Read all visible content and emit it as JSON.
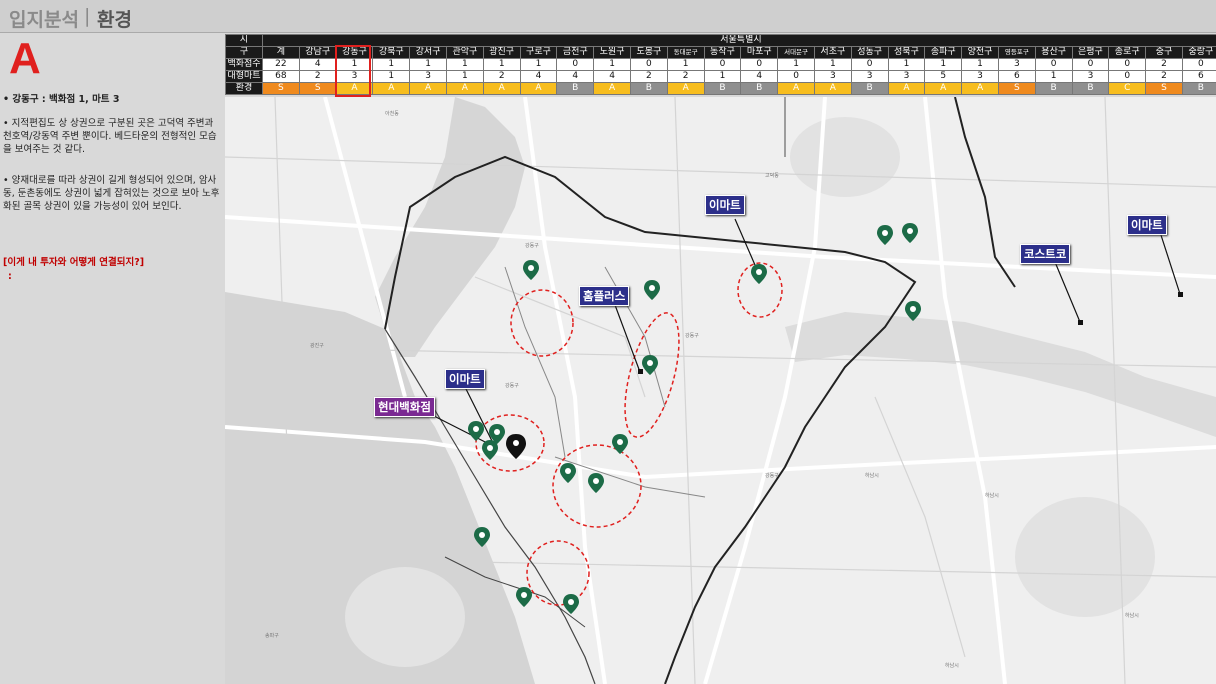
{
  "header": {
    "section": "입지분석",
    "separator": "|",
    "topic": "환경"
  },
  "left": {
    "grade": "A",
    "summary": "• 강동구 : 백화점 1, 마트 3",
    "para1": "• 지적편집도 상 상권으로 구분된 곳은 고덕역 주변과 천호역/강동역 주변 뿐이다. 베드타운의 전형적인 모습을 보여주는 것 같다.",
    "para2": "• 양재대로를 따라 상권이 길게 형성되어 있으며, 암사동, 둔촌동에도 상권이 넓게 잡혀있는 것으로 보아 노후화된 골목 상권이 있을 가능성이 있어 보인다.",
    "question": "[이게 내 투자와 어떻게 연결되지?]",
    "question_colon": ":"
  },
  "table": {
    "row1_label": "시",
    "city": "서울특별시",
    "row2_label": "구",
    "districts": [
      "계",
      "강남구",
      "강동구",
      "강북구",
      "강서구",
      "관악구",
      "광진구",
      "구로구",
      "금천구",
      "노원구",
      "도봉구",
      "동대문구",
      "동작구",
      "마포구",
      "서대문구",
      "서초구",
      "성동구",
      "성북구",
      "송파구",
      "양천구",
      "영등포구",
      "용산구",
      "은평구",
      "종로구",
      "중구",
      "중랑구"
    ],
    "dept_label": "백화점수",
    "dept": [
      "22",
      "4",
      "1",
      "1",
      "1",
      "1",
      "1",
      "1",
      "0",
      "1",
      "0",
      "1",
      "0",
      "0",
      "1",
      "1",
      "0",
      "1",
      "1",
      "1",
      "3",
      "0",
      "0",
      "0",
      "2",
      "0"
    ],
    "mart_label": "대형마트",
    "mart": [
      "68",
      "2",
      "3",
      "1",
      "3",
      "1",
      "2",
      "4",
      "4",
      "4",
      "2",
      "2",
      "1",
      "4",
      "0",
      "3",
      "3",
      "3",
      "5",
      "3",
      "6",
      "1",
      "3",
      "0",
      "2",
      "6"
    ],
    "env_label": "환경",
    "env": [
      "S",
      "S",
      "A",
      "A",
      "A",
      "A",
      "A",
      "A",
      "B",
      "A",
      "B",
      "A",
      "B",
      "B",
      "A",
      "A",
      "B",
      "A",
      "A",
      "A",
      "S",
      "B",
      "B",
      "C",
      "S",
      "B"
    ]
  },
  "map": {
    "labels": {
      "emart1": "이마트",
      "emart2": "이마트",
      "emart3": "이마트",
      "homeplus": "홈플러스",
      "costco": "코스트코",
      "hyundai": "현대백화점"
    }
  }
}
